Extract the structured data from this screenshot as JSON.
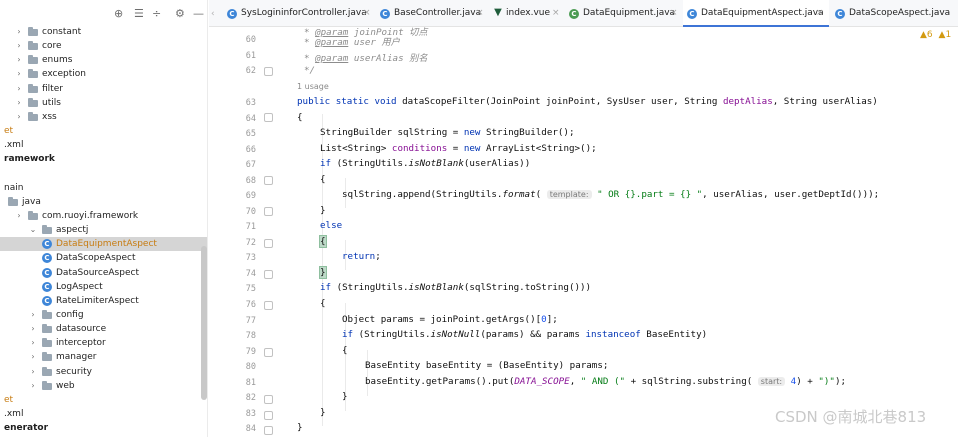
{
  "tree": {
    "toolbar_icons": [
      "target-icon",
      "expand-all-icon",
      "collapse-all-icon",
      "gear-icon",
      "minimize-icon"
    ],
    "rows": [
      {
        "label": "constant",
        "kind": "folder",
        "indent": 1,
        "chevron": ">"
      },
      {
        "label": "core",
        "kind": "folder",
        "indent": 1,
        "chevron": ">"
      },
      {
        "label": "enums",
        "kind": "folder",
        "indent": 1,
        "chevron": ">"
      },
      {
        "label": "exception",
        "kind": "folder",
        "indent": 1,
        "chevron": ">"
      },
      {
        "label": "filter",
        "kind": "folder",
        "indent": 1,
        "chevron": ">"
      },
      {
        "label": "utils",
        "kind": "folder",
        "indent": 1,
        "chevron": ">"
      },
      {
        "label": "xss",
        "kind": "folder",
        "indent": 1,
        "chevron": ">"
      },
      {
        "label": "et",
        "kind": "text",
        "indent": 0,
        "style": "orange"
      },
      {
        "label": ".xml",
        "kind": "text",
        "indent": 0
      },
      {
        "label": "ramework",
        "kind": "text",
        "indent": 0,
        "style": "bold"
      },
      {
        "label": "",
        "kind": "text",
        "indent": 0
      },
      {
        "label": "nain",
        "kind": "text",
        "indent": 0
      },
      {
        "label": "java",
        "kind": "folder",
        "indent": 0
      },
      {
        "label": "com.ruoyi.framework",
        "kind": "folder",
        "indent": 1,
        "chevron": ">"
      },
      {
        "label": "aspectj",
        "kind": "folder",
        "indent": 2,
        "chevron": "v"
      },
      {
        "label": "DataEquipmentAspect",
        "kind": "class",
        "indent": 3,
        "style": "orange",
        "selected": true
      },
      {
        "label": "DataScopeAspect",
        "kind": "class",
        "indent": 3
      },
      {
        "label": "DataSourceAspect",
        "kind": "class",
        "indent": 3
      },
      {
        "label": "LogAspect",
        "kind": "class",
        "indent": 3
      },
      {
        "label": "RateLimiterAspect",
        "kind": "class",
        "indent": 3
      },
      {
        "label": "config",
        "kind": "folder",
        "indent": 2,
        "chevron": ">"
      },
      {
        "label": "datasource",
        "kind": "folder",
        "indent": 2,
        "chevron": ">"
      },
      {
        "label": "interceptor",
        "kind": "folder",
        "indent": 2,
        "chevron": ">"
      },
      {
        "label": "manager",
        "kind": "folder",
        "indent": 2,
        "chevron": ">"
      },
      {
        "label": "security",
        "kind": "folder",
        "indent": 2,
        "chevron": ">"
      },
      {
        "label": "web",
        "kind": "folder",
        "indent": 2,
        "chevron": ">"
      },
      {
        "label": "et",
        "kind": "text",
        "indent": 0,
        "style": "orange"
      },
      {
        "label": ".xml",
        "kind": "text",
        "indent": 0
      },
      {
        "label": "enerator",
        "kind": "text",
        "indent": 0,
        "style": "bold"
      }
    ]
  },
  "tabs": [
    {
      "label": "SysLogininforController.java",
      "icon": "class-icon",
      "active": false
    },
    {
      "label": "BaseController.java",
      "icon": "class-icon",
      "active": false
    },
    {
      "label": "index.vue",
      "icon": "vue-icon",
      "active": false
    },
    {
      "label": "DataEquipment.java",
      "icon": "class-icon",
      "active": false
    },
    {
      "label": "DataEquipmentAspect.java",
      "icon": "class-icon",
      "active": true
    },
    {
      "label": "DataScopeAspect.java",
      "icon": "class-icon",
      "active": false
    }
  ],
  "tab_close_glyph": "×",
  "inspection": {
    "warnings": "6",
    "other": "1"
  },
  "usage_hint": "1 usage",
  "lines": [
    "60",
    "61",
    "62",
    "",
    "63",
    "64",
    "65",
    "66",
    "67",
    "68",
    "69",
    "70",
    "71",
    "72",
    "73",
    "74",
    "75",
    "76",
    "77",
    "78",
    "79",
    "80",
    "81",
    "82",
    "83",
    "84"
  ],
  "watermark": "CSDN @南城北巷813"
}
